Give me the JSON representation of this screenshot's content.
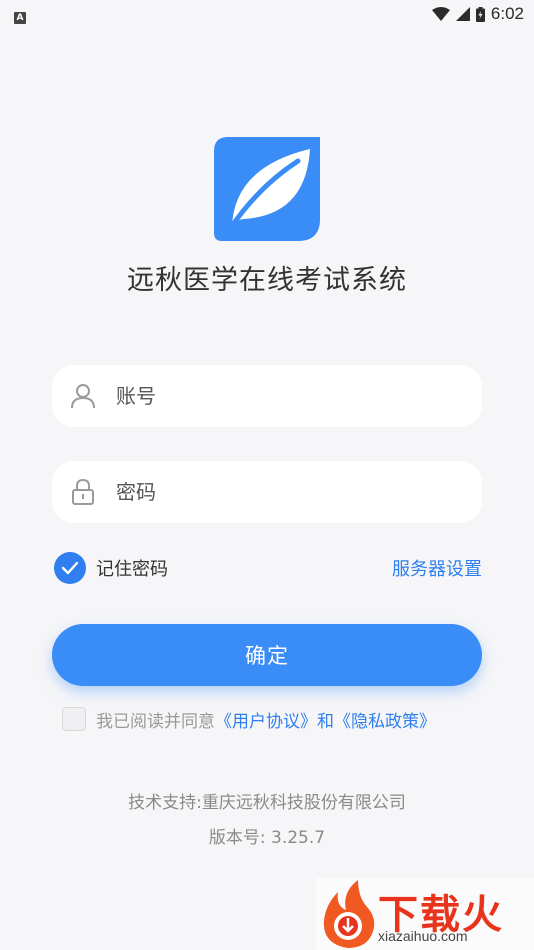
{
  "status_bar": {
    "left_badge": "A",
    "time": "6:02",
    "icons": [
      "wifi-icon",
      "signal-icon",
      "battery-icon"
    ]
  },
  "app": {
    "title": "远秋医学在线考试系统",
    "logo_icon": "leaf-logo-icon",
    "brand_color": "#2f7ff0"
  },
  "login": {
    "account_placeholder": "账号",
    "password_placeholder": "密码",
    "remember_label": "记住密码",
    "remember_checked": true,
    "server_settings_label": "服务器设置",
    "confirm_label": "确定"
  },
  "agreement": {
    "prefix": "我已阅读并同意",
    "user_agreement": "《用户协议》",
    "conjunction": "和",
    "privacy_policy": "《隐私政策》",
    "checked": false
  },
  "footer": {
    "support": "技术支持:重庆远秋科技股份有限公司",
    "version": "版本号: 3.25.7"
  },
  "watermark": {
    "title": "下载火",
    "url": "xiazaihuo.com"
  }
}
